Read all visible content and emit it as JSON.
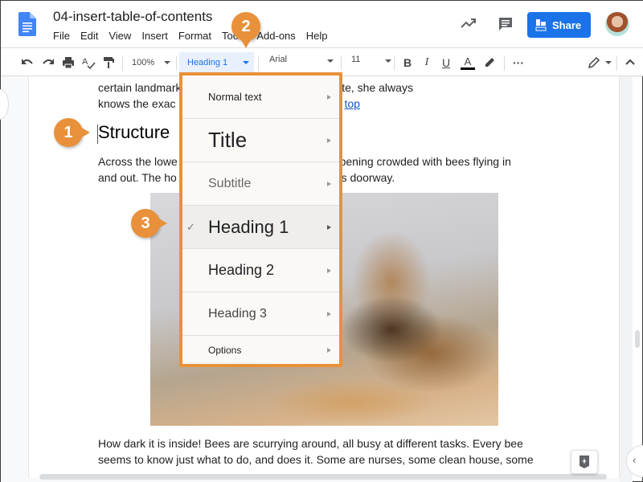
{
  "header": {
    "doc_title": "04-insert-table-of-contents",
    "menu": [
      "File",
      "Edit",
      "View",
      "Insert",
      "Format",
      "Tools",
      "Add-ons",
      "Help"
    ],
    "share_label": "Share",
    "icons": {
      "app_logo": "google-docs-icon",
      "star": "star-icon",
      "activity": "trending-up-icon",
      "comments": "comment-icon",
      "share_lock": "lock-icon",
      "avatar": "user-avatar"
    }
  },
  "toolbar": {
    "zoom": "100%",
    "style": "Heading 1",
    "font": "Arial",
    "font_size": "11",
    "buttons": [
      "undo",
      "redo",
      "print",
      "spellcheck",
      "paint-format",
      "bold",
      "italic",
      "underline",
      "text-color",
      "highlight",
      "more",
      "editing-mode",
      "collapse"
    ],
    "text_color": "#000000"
  },
  "document": {
    "para1_line1": "certain landmarks on her way, perhaps. At any rate, she always",
    "para1_line2_prefix": "knows the exac",
    "para1_link": "top",
    "heading": "Structure",
    "para2_line1_start": "Across the lowe",
    "para2_line1_end": "w opening crowded with bees flying in",
    "para2_line2_start": "and out. The ho",
    "para2_line2_end": "this doorway.",
    "image_alt": "Bees at hive entrance",
    "para3_line1": "How dark it is inside! Bees are scurrying around, all busy at different tasks. Every bee",
    "para3_line2": "seems to know just what to do, and does it. Some are nurses, some clean house, some"
  },
  "style_menu": {
    "items": [
      {
        "label": "Normal text",
        "selected": false
      },
      {
        "label": "Title",
        "selected": false
      },
      {
        "label": "Subtitle",
        "selected": false
      },
      {
        "label": "Heading 1",
        "selected": true
      },
      {
        "label": "Heading 2",
        "selected": false
      },
      {
        "label": "Heading 3",
        "selected": false
      },
      {
        "label": "Options",
        "selected": false
      }
    ],
    "check": "✓"
  },
  "callouts": [
    "1",
    "2",
    "3"
  ],
  "colors": {
    "accent": "#e8913a",
    "share": "#1a73e8",
    "style_select_bg": "#e8f0fe",
    "link": "#1155cc"
  }
}
